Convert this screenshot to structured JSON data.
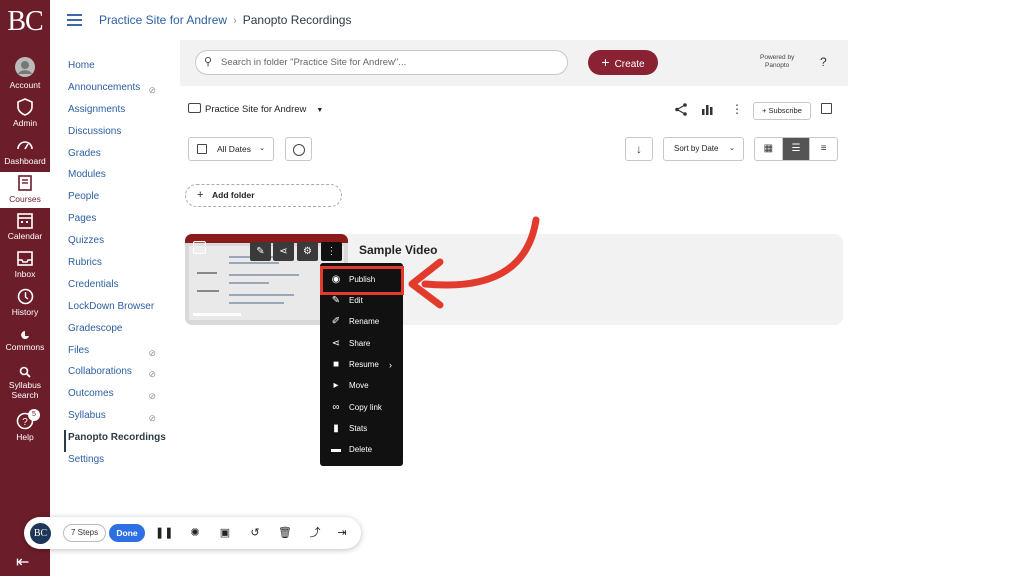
{
  "global_nav": {
    "logo": "BC",
    "items": [
      {
        "label": "Account",
        "icon": "account-icon"
      },
      {
        "label": "Admin",
        "icon": "admin-shield-icon"
      },
      {
        "label": "Dashboard",
        "icon": "dashboard-icon"
      },
      {
        "label": "Courses",
        "icon": "courses-book-icon"
      },
      {
        "label": "Calendar",
        "icon": "calendar-icon"
      },
      {
        "label": "Inbox",
        "icon": "inbox-icon"
      },
      {
        "label": "History",
        "icon": "history-clock-icon"
      },
      {
        "label": "Commons",
        "icon": "commons-icon"
      },
      {
        "label": "Syllabus Search",
        "icon": "syllabus-search-icon"
      },
      {
        "label": "Help",
        "icon": "help-icon",
        "badge": "5"
      }
    ],
    "active": "Courses",
    "brand_color": "#6c1d2a"
  },
  "breadcrumb": {
    "course": "Practice Site for Andrew",
    "page": "Panopto Recordings"
  },
  "course_nav": {
    "items": [
      {
        "label": "Home"
      },
      {
        "label": "Announcements",
        "hidden": true
      },
      {
        "label": "Assignments"
      },
      {
        "label": "Discussions"
      },
      {
        "label": "Grades"
      },
      {
        "label": "Modules"
      },
      {
        "label": "People"
      },
      {
        "label": "Pages"
      },
      {
        "label": "Quizzes"
      },
      {
        "label": "Rubrics"
      },
      {
        "label": "Credentials"
      },
      {
        "label": "LockDown Browser"
      },
      {
        "label": "Gradescope"
      },
      {
        "label": "Files",
        "hidden": true
      },
      {
        "label": "Collaborations",
        "hidden": true
      },
      {
        "label": "Outcomes",
        "hidden": true
      },
      {
        "label": "Syllabus",
        "hidden": true
      },
      {
        "label": "Panopto Recordings",
        "active": true
      },
      {
        "label": "Settings"
      }
    ]
  },
  "panopto": {
    "search_placeholder": "Search in folder \"Practice Site for Andrew\"...",
    "create_label": "Create",
    "powered_by_line1": "Powered by",
    "powered_by_line2": "Panopto",
    "help": "?",
    "folder_name": "Practice Site for Andrew",
    "subscribe_label": "+ Subscribe",
    "date_filter": "All Dates",
    "sort_label": "Sort by Date",
    "add_folder_label": "Add folder",
    "accent_color": "#8b2233",
    "video": {
      "title": "Sample Video"
    },
    "menu": [
      {
        "label": "Publish",
        "icon": "eye-icon",
        "highlighted": true
      },
      {
        "label": "Edit",
        "icon": "edit-clapper-icon"
      },
      {
        "label": "Rename",
        "icon": "pencil-icon"
      },
      {
        "label": "Share",
        "icon": "share-icon"
      },
      {
        "label": "Resume",
        "icon": "video-camera-icon",
        "has_submenu": true
      },
      {
        "label": "Move",
        "icon": "move-folder-icon"
      },
      {
        "label": "Copy link",
        "icon": "link-icon"
      },
      {
        "label": "Stats",
        "icon": "stats-icon"
      },
      {
        "label": "Delete",
        "icon": "trash-icon"
      }
    ],
    "highlight_color": "#e23b2e"
  },
  "recorder": {
    "avatar": "BC",
    "steps": "7 Steps",
    "done": "Done",
    "done_color": "#2f6fe4"
  }
}
